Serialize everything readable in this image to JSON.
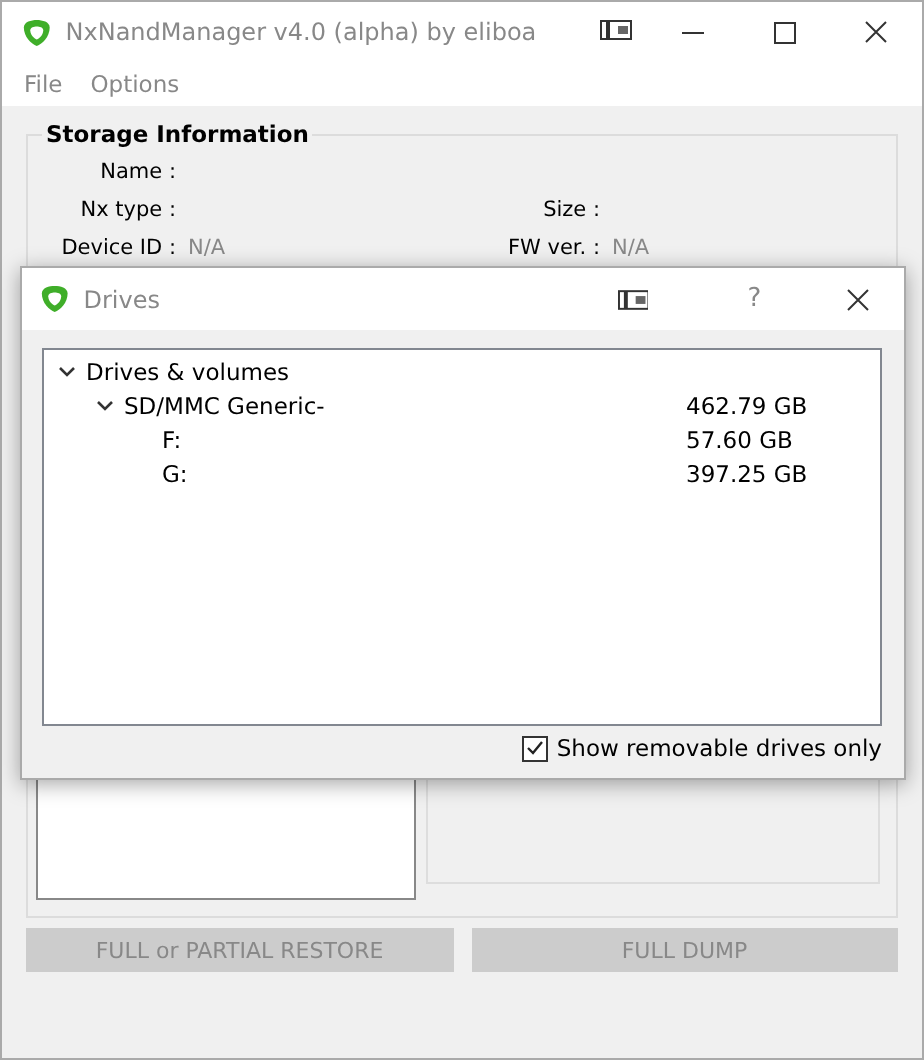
{
  "window": {
    "title": "NxNandManager v4.0 (alpha) by eliboa"
  },
  "menu": [
    "File",
    "Options"
  ],
  "storage_information": {
    "title": "Storage Information",
    "rows": [
      {
        "left": {
          "label": "Name :"
        }
      },
      {
        "left": {
          "label": "Nx type :"
        },
        "right": {
          "label": "Size :"
        }
      },
      {
        "left": {
          "label": "Device ID :",
          "value": "N/A"
        },
        "right": {
          "label": "FW ver. :",
          "value": "N/A"
        }
      }
    ]
  },
  "buttons": [
    {
      "label": "FULL or PARTIAL RESTORE",
      "disabled": true
    },
    {
      "label": "FULL DUMP",
      "disabled": true
    }
  ],
  "dialog": {
    "title": "Drives",
    "help": "?",
    "tree": [
      {
        "label": "Drives & volumes",
        "expanded": true,
        "children": [
          {
            "label": "SD/MMC Generic-",
            "size": "462.79 GB",
            "expanded": true,
            "children": [
              {
                "label": "F:",
                "size": "57.60 GB"
              },
              {
                "label": "G:",
                "size": "397.25 GB"
              }
            ]
          }
        ]
      }
    ],
    "checkbox": {
      "label": "Show removable drives only",
      "checked": true
    }
  }
}
